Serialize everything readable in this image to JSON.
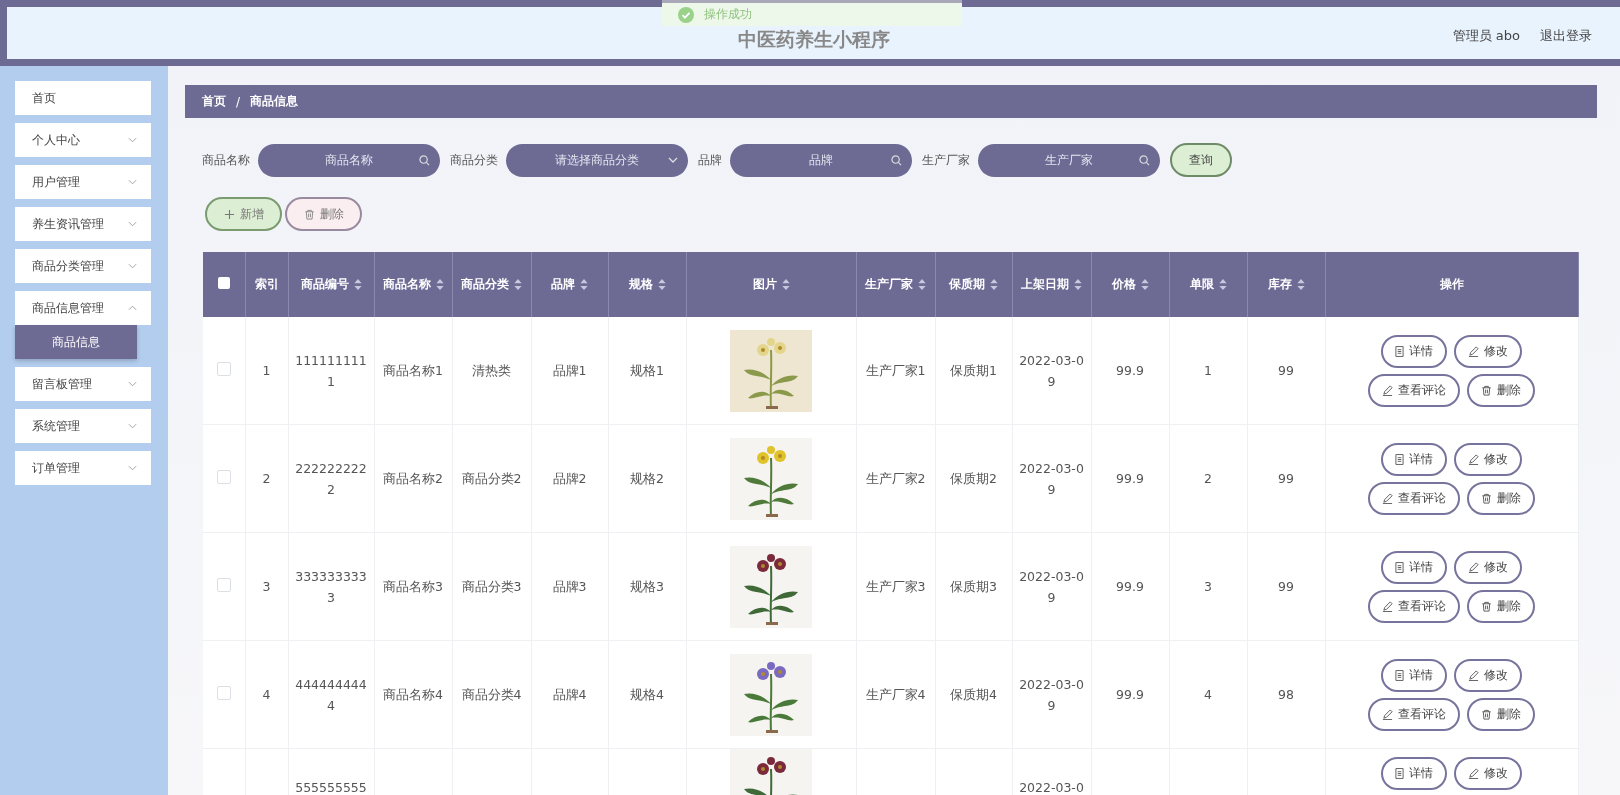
{
  "header": {
    "title": "中医药养生小程序",
    "user": "管理员 abo",
    "logout": "退出登录"
  },
  "toast": {
    "text": "操作成功"
  },
  "sidebar": {
    "items": [
      {
        "label": "首页",
        "kind": "link"
      },
      {
        "label": "个人中心",
        "kind": "menu",
        "expanded": false
      },
      {
        "label": "用户管理",
        "kind": "menu",
        "expanded": false
      },
      {
        "label": "养生资讯管理",
        "kind": "menu",
        "expanded": false
      },
      {
        "label": "商品分类管理",
        "kind": "menu",
        "expanded": false
      },
      {
        "label": "商品信息管理",
        "kind": "menu",
        "expanded": true,
        "children": [
          {
            "label": "商品信息",
            "selected": true
          }
        ]
      },
      {
        "label": "留言板管理",
        "kind": "menu",
        "expanded": false
      },
      {
        "label": "系统管理",
        "kind": "menu",
        "expanded": false
      },
      {
        "label": "订单管理",
        "kind": "menu",
        "expanded": false
      }
    ]
  },
  "breadcrumb": [
    "首页",
    "/",
    "商品信息"
  ],
  "filters": [
    {
      "label": "商品名称",
      "kind": "search",
      "placeholder": "商品名称"
    },
    {
      "label": "商品分类",
      "kind": "select",
      "placeholder": "请选择商品分类"
    },
    {
      "label": "品牌",
      "kind": "search",
      "placeholder": "品牌"
    },
    {
      "label": "生产厂家",
      "kind": "search",
      "placeholder": "生产厂家"
    }
  ],
  "query_button": "查询",
  "actions": [
    {
      "label": "新增",
      "kind": "add"
    },
    {
      "label": "删除",
      "kind": "delete"
    }
  ],
  "table": {
    "select_all": {
      "checked": false
    },
    "columns": [
      {
        "label": "索引",
        "sortable": false
      },
      {
        "label": "商品编号",
        "sortable": true
      },
      {
        "label": "商品名称",
        "sortable": true
      },
      {
        "label": "商品分类",
        "sortable": true
      },
      {
        "label": "品牌",
        "sortable": true
      },
      {
        "label": "规格",
        "sortable": true
      },
      {
        "label": "图片",
        "sortable": true
      },
      {
        "label": "生产厂家",
        "sortable": true
      },
      {
        "label": "保质期",
        "sortable": true
      },
      {
        "label": "上架日期",
        "sortable": true
      },
      {
        "label": "价格",
        "sortable": true
      },
      {
        "label": "单限",
        "sortable": true
      },
      {
        "label": "库存",
        "sortable": true
      },
      {
        "label": "操作",
        "sortable": false
      }
    ],
    "rows": [
      {
        "checked": false,
        "cells": [
          "1",
          "1111111111",
          "商品名称1",
          "清热类",
          "品牌1",
          "规格1",
          "",
          "生产厂家1",
          "保质期1",
          "2022-03-09",
          "99.9",
          "1",
          "99"
        ],
        "picture": {
          "kind": "picture"
        },
        "buttons": [
          {
            "label": "详情",
            "kind": "detail"
          },
          {
            "label": "修改",
            "kind": "edit"
          },
          {
            "label": "查看评论",
            "kind": "comment"
          },
          {
            "label": "删除",
            "kind": "delete"
          }
        ]
      },
      {
        "checked": false,
        "cells": [
          "2",
          "2222222222",
          "商品名称2",
          "商品分类2",
          "品牌2",
          "规格2",
          "",
          "生产厂家2",
          "保质期2",
          "2022-03-09",
          "99.9",
          "2",
          "99"
        ],
        "picture": {
          "kind": "picture"
        },
        "buttons": [
          {
            "label": "详情",
            "kind": "detail"
          },
          {
            "label": "修改",
            "kind": "edit"
          },
          {
            "label": "查看评论",
            "kind": "comment"
          },
          {
            "label": "删除",
            "kind": "delete"
          }
        ]
      },
      {
        "checked": false,
        "cells": [
          "3",
          "3333333333",
          "商品名称3",
          "商品分类3",
          "品牌3",
          "规格3",
          "",
          "生产厂家3",
          "保质期3",
          "2022-03-09",
          "99.9",
          "3",
          "99"
        ],
        "picture": {
          "kind": "picture"
        },
        "buttons": [
          {
            "label": "详情",
            "kind": "detail"
          },
          {
            "label": "修改",
            "kind": "edit"
          },
          {
            "label": "查看评论",
            "kind": "comment"
          },
          {
            "label": "删除",
            "kind": "delete"
          }
        ]
      },
      {
        "checked": false,
        "cells": [
          "4",
          "4444444444",
          "商品名称4",
          "商品分类4",
          "品牌4",
          "规格4",
          "",
          "生产厂家4",
          "保质期4",
          "2022-03-09",
          "99.9",
          "4",
          "98"
        ],
        "picture": {
          "kind": "picture"
        },
        "buttons": [
          {
            "label": "详情",
            "kind": "detail"
          },
          {
            "label": "修改",
            "kind": "edit"
          },
          {
            "label": "查看评论",
            "kind": "comment"
          },
          {
            "label": "删除",
            "kind": "delete"
          }
        ]
      },
      {
        "cells": [
          "",
          "555555555",
          "",
          "",
          "",
          "",
          "",
          "",
          "",
          "2022-03-0",
          "",
          "",
          ""
        ],
        "picture": {
          "kind": "picture"
        },
        "buttons": [
          {
            "label": "详情",
            "kind": "detail"
          },
          {
            "label": "修改",
            "kind": "edit"
          }
        ]
      }
    ]
  }
}
